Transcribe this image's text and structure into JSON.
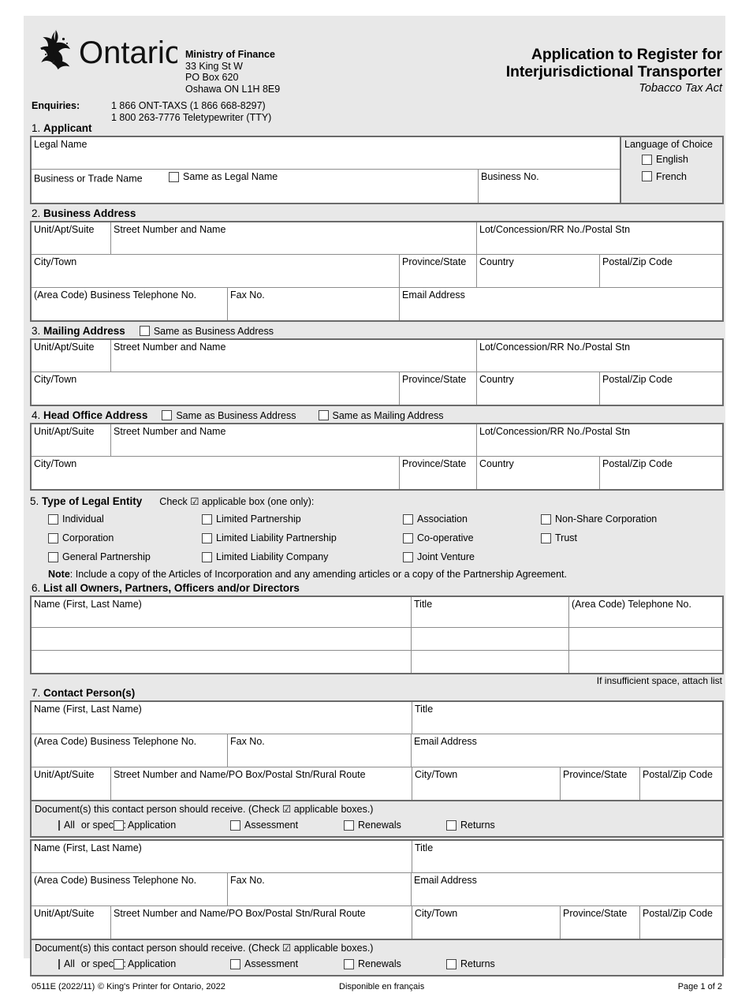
{
  "header": {
    "logo_text": "Ontario",
    "ministry_name": "Ministry of Finance",
    "address_line1": "33 King St W",
    "address_line2": "PO Box 620",
    "address_line3": "Oshawa ON  L1H 8E9",
    "enquiries_label": "Enquiries:",
    "enquiries_line1": "1 866 ONT-TAXS (1 866 668-8297)",
    "enquiries_line2": "1 800 263-7776 Teletypewriter (TTY)",
    "title_line1": "Application to Register for",
    "title_line2": "Interjurisdictional Transporter",
    "subtitle": "Tobacco Tax Act"
  },
  "section1": {
    "number": "1.",
    "title": "Applicant",
    "legal_name_label": "Legal Name",
    "business_trade_name_label": "Business or Trade Name",
    "same_as_legal_name_label": "Same as Legal Name",
    "business_no_label": "Business No.",
    "language_of_choice_label": "Language of Choice",
    "english_label": "English",
    "french_label": "French"
  },
  "section2": {
    "number": "2.",
    "title": "Business Address",
    "unit_label": "Unit/Apt/Suite",
    "street_label": "Street Number and Name",
    "lot_label": "Lot/Concession/RR No./Postal Stn",
    "city_label": "City/Town",
    "province_label": "Province/State",
    "country_label": "Country",
    "postal_label": "Postal/Zip Code",
    "telephone_label": "(Area Code) Business Telephone No.",
    "fax_label": "Fax No.",
    "email_label": "Email Address"
  },
  "section3": {
    "number": "3.",
    "title": "Mailing Address",
    "same_as_business_label": "Same as Business Address",
    "unit_label": "Unit/Apt/Suite",
    "street_label": "Street Number and Name",
    "lot_label": "Lot/Concession/RR No./Postal Stn",
    "city_label": "City/Town",
    "province_label": "Province/State",
    "country_label": "Country",
    "postal_label": "Postal/Zip Code"
  },
  "section4": {
    "number": "4.",
    "title": "Head Office Address",
    "same_as_business_label": "Same as Business Address",
    "same_as_mailing_label": "Same as Mailing Address",
    "unit_label": "Unit/Apt/Suite",
    "street_label": "Street Number and Name",
    "lot_label": "Lot/Concession/RR No./Postal Stn",
    "city_label": "City/Town",
    "province_label": "Province/State",
    "country_label": "Country",
    "postal_label": "Postal/Zip Code"
  },
  "section5": {
    "number": "5.",
    "title": "Type of Legal Entity",
    "instruction": "Check ☑ applicable box (one only):",
    "options": [
      "Individual",
      "Limited Partnership",
      "Association",
      "Non-Share Corporation",
      "Corporation",
      "Limited Liability Partnership",
      "Co-operative",
      "Trust",
      "General Partnership",
      "Limited Liability Company",
      "Joint Venture"
    ],
    "note_label": "Note",
    "note_text": ": Include a copy of the Articles of Incorporation and any amending articles or a copy of the Partnership Agreement."
  },
  "section6": {
    "number": "6.",
    "title": "List all Owners, Partners, Officers and/or Directors",
    "columns": [
      "Name (First, Last Name)",
      "Title",
      "(Area Code) Telephone No."
    ],
    "rows": [
      [
        "",
        "",
        ""
      ],
      [
        "",
        "",
        ""
      ],
      [
        "",
        "",
        ""
      ]
    ],
    "footnote": "If insufficient space, attach list"
  },
  "section7": {
    "number": "7.",
    "title": "Contact Person(s)",
    "name_label": "Name (First, Last Name)",
    "title_label": "Title",
    "telephone_label": "(Area Code) Business Telephone No.",
    "fax_label": "Fax No.",
    "email_label": "Email Address",
    "unit_label": "Unit/Apt/Suite",
    "street_label": "Street Number and Name/PO Box/Postal Stn/Rural Route",
    "city_label": "City/Town",
    "province_label": "Province/State",
    "postal_label": "Postal/Zip Code",
    "documents_instruction": "Document(s) this contact person should receive. (Check ☑ applicable boxes.)",
    "all_label": "All",
    "or_specify_label": "or specify:",
    "doc_options": [
      "Application",
      "Assessment",
      "Renewals",
      "Returns"
    ]
  },
  "footer": {
    "form_id": "0511E (2022/11)",
    "copyright": "© King's Printer for Ontario, 2022",
    "french_note": "Disponible en français",
    "page_number": "Page 1 of 2"
  },
  "colors": {
    "page_background": "#e8e8e8",
    "field_background": "#ffffff",
    "border_outer": "#6a6a6a",
    "border_inner": "#8d8d8d"
  }
}
